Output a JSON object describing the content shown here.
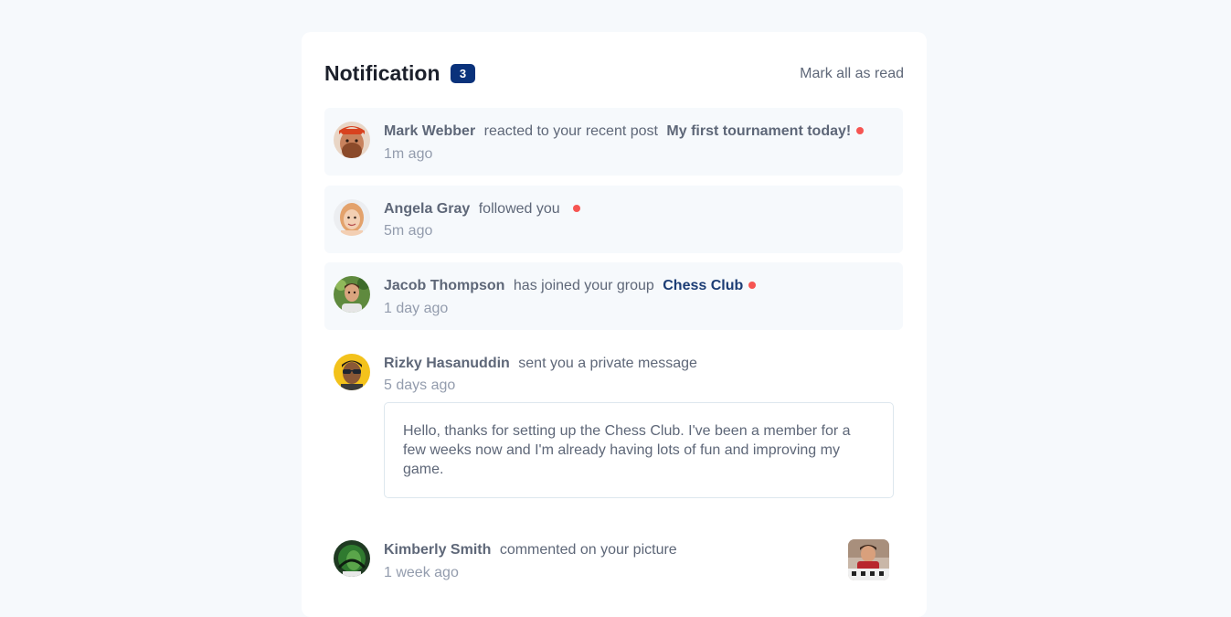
{
  "header": {
    "title": "Notification",
    "unread_count": "3",
    "mark_all_label": "Mark all as read"
  },
  "colors": {
    "badge_bg": "#0a327b",
    "unread_dot": "#f65552",
    "unread_bg": "#f6f9fc"
  },
  "notifications": [
    {
      "name": "Mark Webber",
      "action": "reacted to your recent post",
      "target": "My first tournament today!",
      "time": "1m ago",
      "unread": true
    },
    {
      "name": "Angela Gray",
      "action": "followed you",
      "target": "",
      "time": "5m ago",
      "unread": true
    },
    {
      "name": "Jacob Thompson",
      "action": "has joined your group",
      "target": "Chess Club",
      "time": "1 day ago",
      "unread": true
    },
    {
      "name": "Rizky Hasanuddin",
      "action": "sent you a private message",
      "target": "",
      "time": "5 days ago",
      "unread": false,
      "message": "Hello, thanks for setting up the Chess Club. I've been a member for a few weeks now and I'm already having lots of fun and improving my game."
    },
    {
      "name": "Kimberly Smith",
      "action": "commented on your picture",
      "target": "",
      "time": "1 week ago",
      "unread": false,
      "thumbnail_icon": "chess-photo-thumbnail"
    }
  ]
}
